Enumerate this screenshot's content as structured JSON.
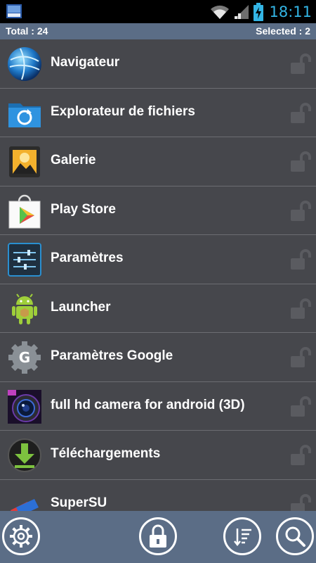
{
  "status_bar": {
    "time": "18:11",
    "accent": "#33b5e5"
  },
  "summary": {
    "total": "Total : 24",
    "selected": "Selected : 2"
  },
  "apps": [
    {
      "name": "Navigateur",
      "icon": "globe-icon"
    },
    {
      "name": "Explorateur de fichiers",
      "icon": "folder-sync-icon"
    },
    {
      "name": "Galerie",
      "icon": "gallery-icon"
    },
    {
      "name": "Play Store",
      "icon": "play-store-icon"
    },
    {
      "name": "Paramètres",
      "icon": "settings-sliders-icon"
    },
    {
      "name": "Launcher",
      "icon": "android-robot-icon"
    },
    {
      "name": "Paramètres Google",
      "icon": "google-settings-icon"
    },
    {
      "name": "full hd camera for android (3D)",
      "icon": "camera-lens-icon"
    },
    {
      "name": "Téléchargements",
      "icon": "download-icon"
    },
    {
      "name": "SuperSU",
      "icon": "supersu-icon"
    }
  ],
  "bottom_bar": {
    "buttons": [
      "gear-icon",
      "lock-icon",
      "sort-icon",
      "search-icon"
    ]
  },
  "colors": {
    "bar": "#5b6d86",
    "list_bg": "#46474c",
    "divider": "#6c6d72"
  }
}
